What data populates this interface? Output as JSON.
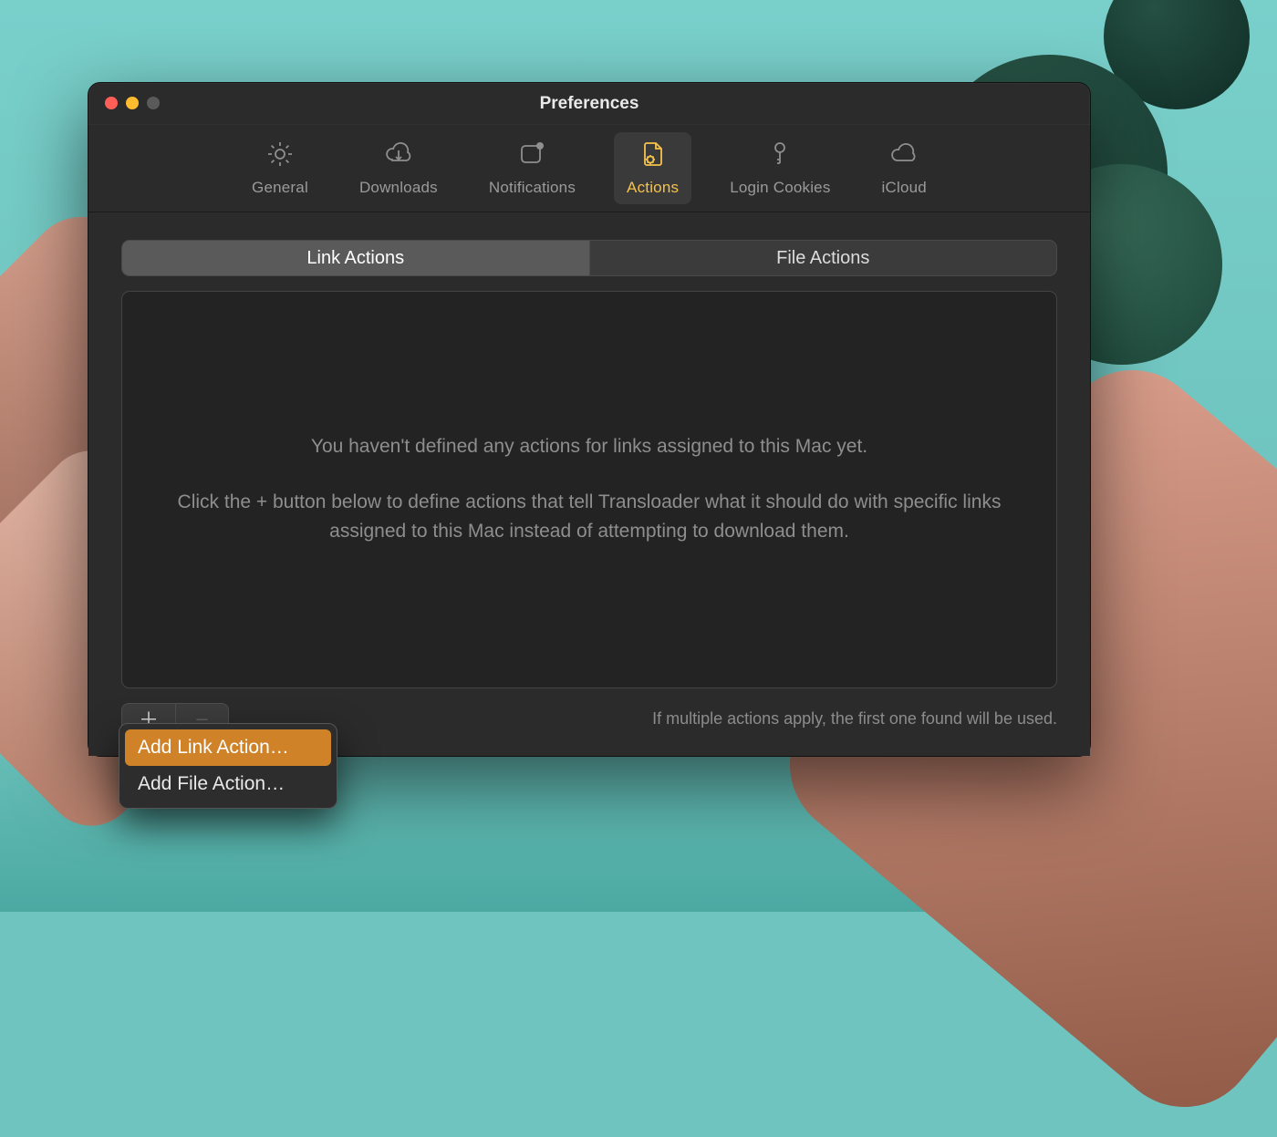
{
  "window": {
    "title": "Preferences"
  },
  "toolbar": {
    "general": "General",
    "downloads": "Downloads",
    "notifications": "Notifications",
    "actions": "Actions",
    "login_cookies": "Login Cookies",
    "icloud": "iCloud",
    "selected": "actions"
  },
  "segmented": {
    "link_actions": "Link Actions",
    "file_actions": "File Actions",
    "active": "link_actions"
  },
  "empty_state": {
    "line1": "You haven't defined any actions for links assigned to this Mac yet.",
    "line2": "Click the + button below to define actions that tell Transloader what it should do with specific links assigned to this Mac instead of attempting to download them."
  },
  "footer": {
    "hint": "If multiple actions apply, the first one found will be used."
  },
  "add_menu": {
    "add_link": "Add Link Action…",
    "add_file": "Add File Action…",
    "highlighted": "add_link"
  },
  "colors": {
    "accent": "#f6c34a",
    "menu_highlight": "#cf8228"
  }
}
